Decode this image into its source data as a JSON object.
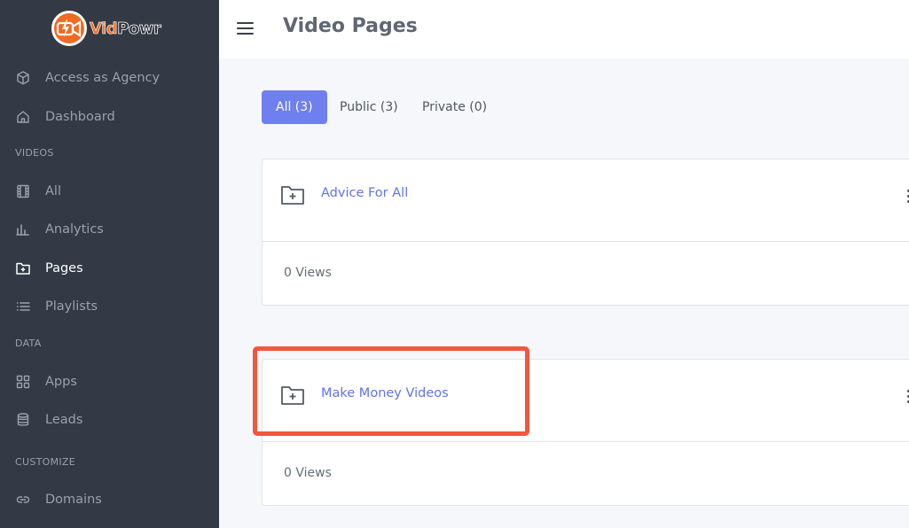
{
  "brand": {
    "vid": "Vid",
    "powr": "Powr"
  },
  "sidebar": {
    "items": [
      {
        "label": "Access as Agency",
        "icon": "cube-icon"
      },
      {
        "label": "Dashboard",
        "icon": "home-icon"
      },
      {
        "label": "All",
        "icon": "film-icon"
      },
      {
        "label": "Analytics",
        "icon": "bar-chart-icon"
      },
      {
        "label": "Pages",
        "icon": "folder-plus-icon"
      },
      {
        "label": "Playlists",
        "icon": "list-icon"
      },
      {
        "label": "Apps",
        "icon": "grid-icon"
      },
      {
        "label": "Leads",
        "icon": "database-icon"
      },
      {
        "label": "Domains",
        "icon": "link-icon"
      }
    ],
    "sections": {
      "videos": "VIDEOS",
      "data": "DATA",
      "customize": "CUSTOMIZE"
    },
    "active": "Pages"
  },
  "header": {
    "title": "Video Pages"
  },
  "tabs": [
    {
      "label": "All (3)",
      "active": true
    },
    {
      "label": "Public (3)",
      "active": false
    },
    {
      "label": "Private (0)",
      "active": false
    }
  ],
  "cards": [
    {
      "title": "Advice For All",
      "views": "0 Views"
    },
    {
      "title": "Make Money Videos",
      "views": "0 Views"
    }
  ],
  "colors": {
    "sidebar_bg": "#333a45",
    "accent": "#6f7ff0",
    "link": "#6373e6",
    "highlight": "#f2573d",
    "brand_orange": "#f06a24"
  }
}
